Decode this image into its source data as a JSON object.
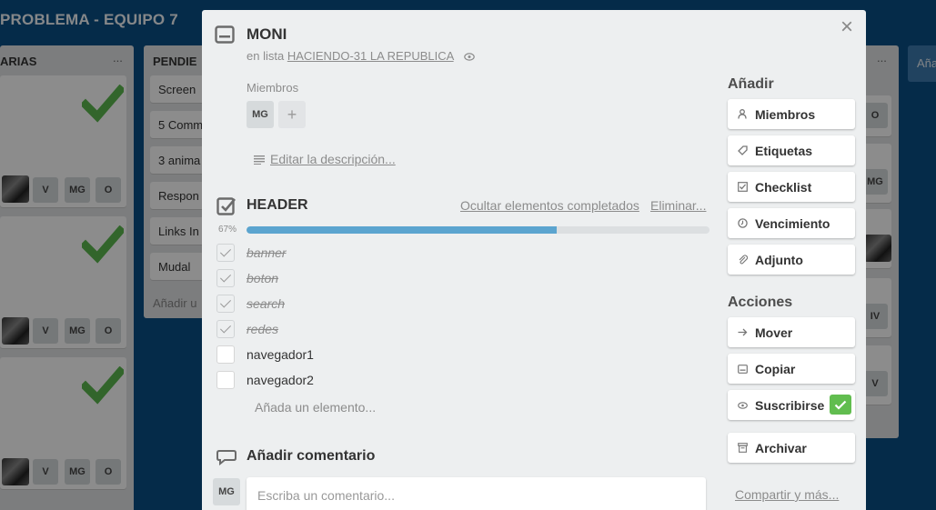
{
  "board": {
    "title": "PROBLEMA - EQUIPO 7",
    "lists": [
      {
        "title": "ARIAS",
        "menu": "..."
      },
      {
        "title": "PENDIE",
        "menu": "..."
      },
      {
        "title": "",
        "menu": "..."
      },
      {
        "title": "Aña"
      }
    ],
    "pending_cards": [
      "Screen",
      "5 Comm",
      "3 anima",
      "Respon",
      "Links In",
      "Mudal"
    ],
    "pending_add": "Añadir u",
    "card_members": [
      "V",
      "MG",
      "O"
    ],
    "right_badges": [
      "O",
      "MG",
      "IV",
      "V"
    ]
  },
  "card": {
    "title": "MONI",
    "in_list_prefix": "en lista",
    "list_name": "HACIENDO-31 LA REPUBLICA",
    "members_label": "Miembros",
    "member_initials": "MG",
    "add_member": "+",
    "edit_description": "Editar la descripción...",
    "close": "×"
  },
  "checklist": {
    "title": "HEADER",
    "hide_completed": "Ocultar elementos completados",
    "delete": "Eliminar...",
    "progress_label": "67%",
    "progress": 0.67,
    "items": [
      {
        "text": "banner",
        "done": true
      },
      {
        "text": "boton",
        "done": true
      },
      {
        "text": "search",
        "done": true
      },
      {
        "text": "redes",
        "done": true
      },
      {
        "text": "navegador1",
        "done": false
      },
      {
        "text": "navegador2",
        "done": false
      }
    ],
    "add_item": "Añada un elemento..."
  },
  "comment": {
    "title": "Añadir comentario",
    "avatar": "MG",
    "placeholder": "Escriba un comentario..."
  },
  "sidebar": {
    "add_heading": "Añadir",
    "add_buttons": [
      {
        "label": "Miembros",
        "icon": "person-icon"
      },
      {
        "label": "Etiquetas",
        "icon": "tag-icon"
      },
      {
        "label": "Checklist",
        "icon": "checklist-icon"
      },
      {
        "label": "Vencimiento",
        "icon": "clock-icon"
      },
      {
        "label": "Adjunto",
        "icon": "paperclip-icon"
      }
    ],
    "actions_heading": "Acciones",
    "action_buttons": [
      {
        "label": "Mover",
        "icon": "arrow-right-icon"
      },
      {
        "label": "Copiar",
        "icon": "card-icon"
      },
      {
        "label": "Suscribirse",
        "icon": "eye-icon"
      },
      {
        "label": "Archivar",
        "icon": "archive-icon"
      }
    ],
    "share": "Compartir y más..."
  },
  "colors": {
    "board_bg": "#0a4f86",
    "progress_fill": "#5ba4cf",
    "subscribed_green": "#61bd4f"
  }
}
